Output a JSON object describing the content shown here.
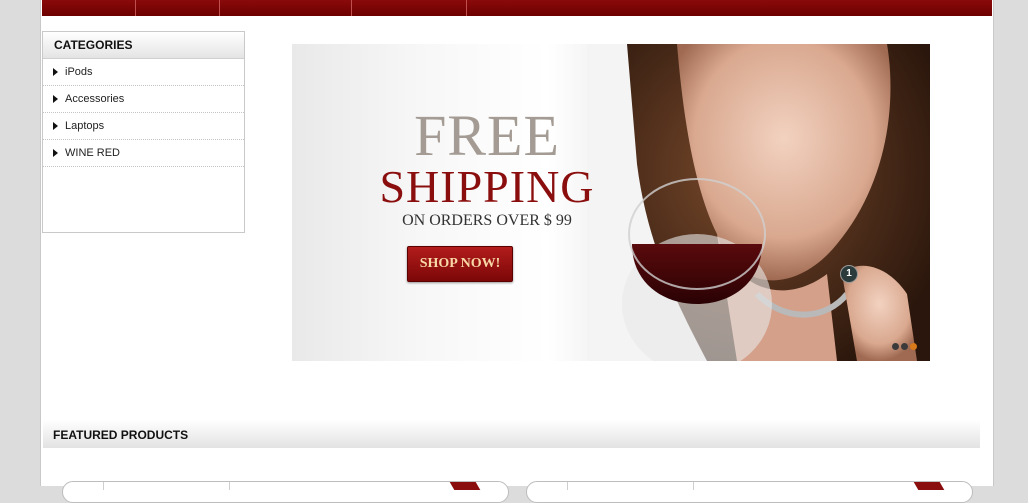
{
  "sidebar": {
    "title": "CATEGORIES",
    "items": [
      {
        "label": "iPods"
      },
      {
        "label": "Accessories"
      },
      {
        "label": "Laptops"
      },
      {
        "label": "WINE RED"
      }
    ]
  },
  "banner": {
    "headline": "FREE",
    "subheadline": "SHIPPING",
    "offer": "ON ORDERS OVER $ 99",
    "button_label": "SHOP NOW!",
    "slide_number": "1",
    "slide_count": 3,
    "active_slide": 3
  },
  "featured": {
    "title": "FEATURED PRODUCTS"
  },
  "colors": {
    "brand": "#7b0000",
    "accent": "#8b0e0e",
    "button_text": "#f7d8a6"
  }
}
